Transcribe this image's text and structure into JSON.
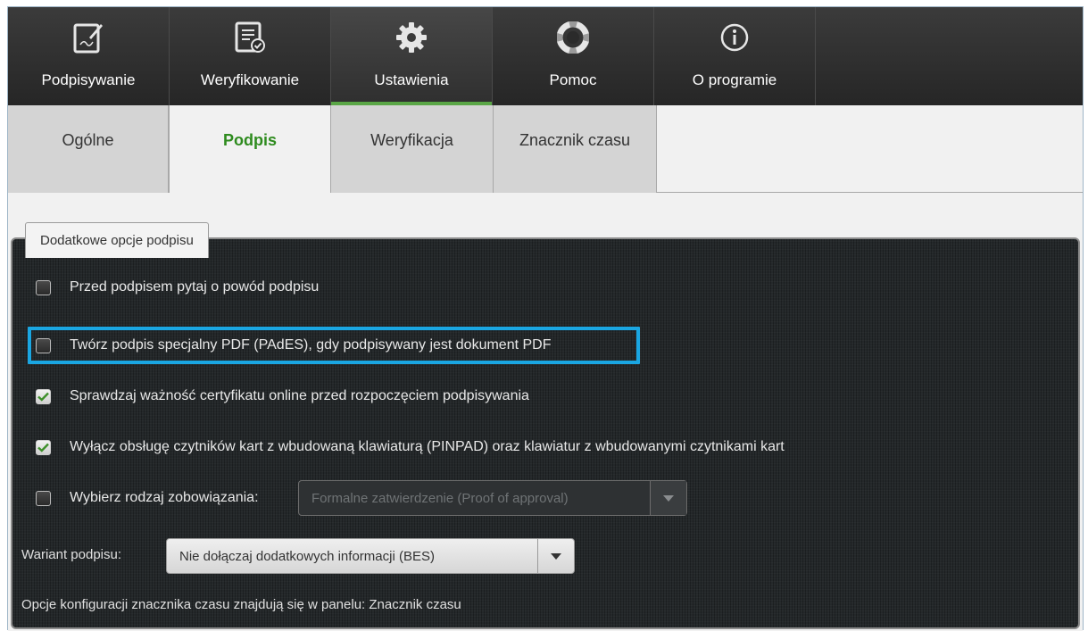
{
  "toolbar": {
    "items": [
      {
        "label": "Podpisywanie",
        "icon": "sign-document-icon"
      },
      {
        "label": "Weryfikowanie",
        "icon": "verify-document-icon"
      },
      {
        "label": "Ustawienia",
        "icon": "gear-icon"
      },
      {
        "label": "Pomoc",
        "icon": "lifebuoy-icon"
      },
      {
        "label": "O programie",
        "icon": "info-icon"
      }
    ],
    "active": "Ustawienia"
  },
  "subtabs": {
    "items": [
      "Ogólne",
      "Podpis",
      "Weryfikacja",
      "Znacznik czasu"
    ],
    "active": "Podpis"
  },
  "group": {
    "title": "Dodatkowe opcje podpisu"
  },
  "options": [
    {
      "label": "Przed podpisem pytaj o powód podpisu",
      "checked": false
    },
    {
      "label": "Twórz podpis specjalny PDF (PAdES), gdy podpisywany jest dokument PDF",
      "checked": false
    },
    {
      "label": "Sprawdzaj ważność certyfikatu online przed rozpoczęciem podpisywania",
      "checked": true
    },
    {
      "label": "Wyłącz obsługę czytników kart z wbudowaną klawiaturą (PINPAD) oraz klawiatur z wbudowanymi czytnikami kart",
      "checked": true
    },
    {
      "label": "Wybierz rodzaj zobowiązania:",
      "checked": false
    }
  ],
  "commitment_select": {
    "value": "Formalne zatwierdzenie (Proof of approval)",
    "disabled": true
  },
  "variant": {
    "label": "Wariant podpisu:",
    "value": "Nie dołączaj dodatkowych informacji (BES)"
  },
  "footer_note": "Opcje konfiguracji znacznika czasu znajdują się w panelu: Znacznik czasu",
  "colors": {
    "accent_green": "#5aa646",
    "active_subtab_text": "#2e8b1e",
    "highlight_blue": "#1aa6e2",
    "panel_bg": "#24282a"
  }
}
